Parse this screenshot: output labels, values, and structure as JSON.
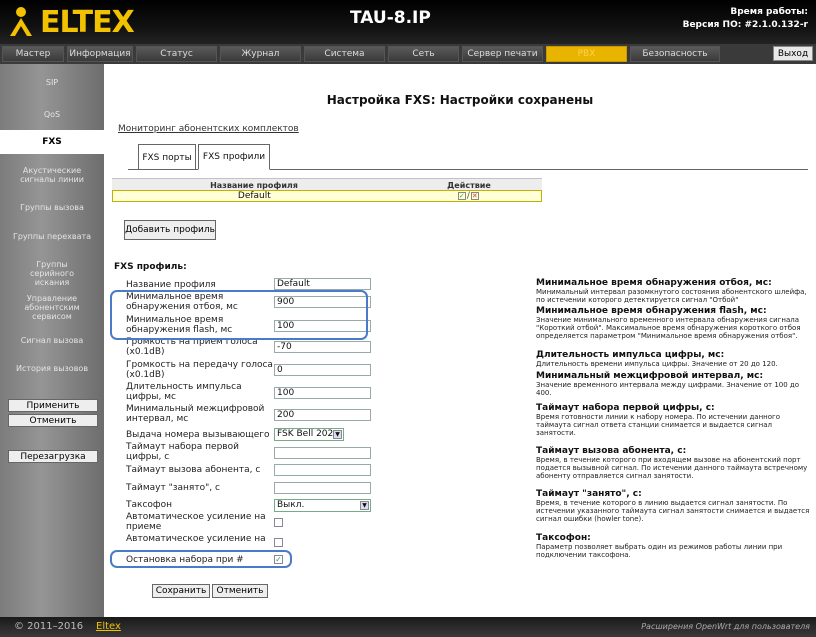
{
  "header": {
    "logo": "ELTEX",
    "product": "TAU-8.IP",
    "uptime_label": "Время работы:",
    "fw_label": "Версия ПО: #2.1.0.132-r"
  },
  "menu": [
    "Мастер",
    "Информация",
    "Статус",
    "Журнал",
    "Система",
    "Сеть",
    "Сервер печати",
    "PBX",
    "Безопасность"
  ],
  "exit_label": "Выход",
  "sidebar": {
    "items": [
      "SIP",
      "QoS",
      "FXS",
      "Акустические сигналы линии",
      "Группы вызова",
      "Группы перехвата",
      "Группы серийного искания",
      "Управление абонентским сервисом",
      "Сигнал вызова",
      "История вызовов"
    ],
    "apply": "Применить",
    "cancel": "Отменить",
    "reboot": "Перезагрузка"
  },
  "page_title": "Настройка FXS: Настройки сохранены",
  "monitor_link": "Мониторинг абонентских комплектов",
  "tabs": [
    "FXS порты",
    "FXS профили"
  ],
  "profile_table": {
    "headers": [
      "Название профиля",
      "Действие"
    ],
    "rows": [
      {
        "name": "Default",
        "action": "✓ / ✕"
      }
    ]
  },
  "add_profile": "Добавить профиль",
  "fxs_label": "FXS профиль:",
  "fields": [
    {
      "label": "Название профиля",
      "value": "Default"
    },
    {
      "label": "Минимальное время обнаружения отбоя, мс",
      "value": "900"
    },
    {
      "label": "Минимальное время обнаружения flash, мс",
      "value": "100"
    },
    {
      "label": "Громкость на прием голоса (x0.1dB)",
      "value": "-70"
    },
    {
      "label": "Громкость на передачу голоса (x0.1dB)",
      "value": "0"
    },
    {
      "label": "Длительность импульса цифры, мс",
      "value": "100"
    },
    {
      "label": "Минимальный межцифровой интервал, мс",
      "value": "200"
    },
    {
      "label": "Выдача номера вызывающего",
      "value": "FSK Bell 202"
    },
    {
      "label": "Таймаут набора первой цифры, с",
      "value": ""
    },
    {
      "label": "Таймаут вызова абонента, с",
      "value": ""
    },
    {
      "label": "Таймаут \"занято\", с",
      "value": ""
    },
    {
      "label": "Таксофон",
      "value": "Выкл."
    },
    {
      "label": "Автоматическое усиление на приеме",
      "value": ""
    },
    {
      "label": "Автоматическое усиление на передаче",
      "value": ""
    },
    {
      "label": "Остановка набора при #",
      "value": "✓"
    }
  ],
  "save": "Сохранить",
  "cancel": "Отменить",
  "help": [
    {
      "title": "Минимальное время обнаружения отбоя, мс:",
      "text": "Минимальный интервал разомкнутого состояния абонентского шлейфа, по истечении которого детектируется сигнал \"Отбой\""
    },
    {
      "title": "Минимальное время обнаружения flash, мс:",
      "text": "Значение минимального временного интервала обнаружения сигнала \"Короткий отбой\". Максимальное время обнаружения короткого отбоя определяется параметром \"Минимальное время обнаружения отбоя\"."
    },
    {
      "title": "Длительность импульса цифры, мс:",
      "text": "Длительность времени импульса цифры. Значение от 20 до 120."
    },
    {
      "title": "Минимальный межцифровой интервал, мс:",
      "text": "Значение временного интервала между цифрами. Значение от 100 до 400."
    },
    {
      "title": "Таймаут набора первой цифры, с:",
      "text": "Время готовности линии к набору номера. По истечении данного таймаута сигнал ответа станции снимается и выдается сигнал занятости."
    },
    {
      "title": "Таймаут вызова абонента, с:",
      "text": "Время, в течение которого при входящем вызове на абонентский порт подается вызывной сигнал. По истечении данного таймаута встречному абоненту отправляется сигнал занятости."
    },
    {
      "title": "Таймаут \"занято\", с:",
      "text": "Время, в течение которого в линию выдается сигнал занятости. По истечении указанного таймаута сигнал занятости снимается и выдается сигнал ошибки (howler tone)."
    },
    {
      "title": "Таксофон:",
      "text": "Параметр позволяет выбрать один из режимов работы линии при подключении таксофона."
    }
  ],
  "footer": {
    "copyright": "© 2011–2016",
    "link": "Eltex",
    "right": "Расширения OpenWrt для пользователя"
  },
  "colors": {
    "accent": "#f2c200",
    "highlight": "#4a7bc8",
    "menu_active": "#e8b400"
  }
}
